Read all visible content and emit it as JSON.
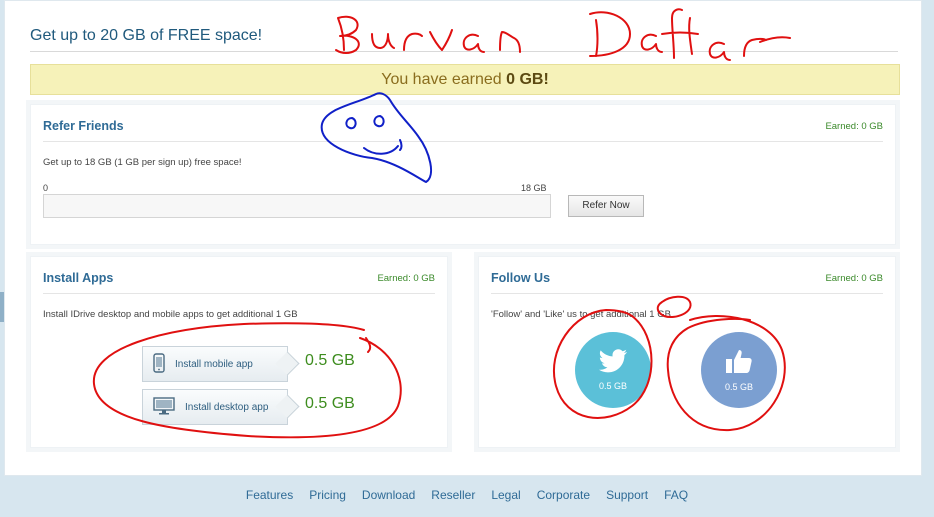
{
  "header": {
    "title": "Get up to 20 GB of FREE space!"
  },
  "banner": {
    "prefix": "You have earned ",
    "amount": "0 GB!"
  },
  "refer": {
    "title": "Refer Friends",
    "earned": "Earned: 0 GB",
    "desc": "Get up to 18 GB (1 GB per sign up) free space!",
    "scale_min": "0",
    "scale_max": "18 GB",
    "progress_fraction": 0,
    "button": "Refer Now"
  },
  "apps": {
    "title": "Install Apps",
    "earned": "Earned: 0 GB",
    "desc": "Install IDrive desktop and mobile apps to get additional 1 GB",
    "mobile_label": "Install mobile app",
    "mobile_gb": "0.5 GB",
    "desktop_label": "Install desktop app",
    "desktop_gb": "0.5 GB"
  },
  "follow": {
    "title": "Follow Us",
    "earned": "Earned: 0 GB",
    "desc": "'Follow' and 'Like' us to get additional 1 GB",
    "twitter_gb": "0.5 GB",
    "facebook_gb": "0.5 GB",
    "twitter_color": "#5bc0d8",
    "facebook_color": "#7b9fd1"
  },
  "footer": {
    "links": [
      "Features",
      "Pricing",
      "Download",
      "Reseller",
      "Legal",
      "Corporate",
      "Support",
      "FAQ"
    ]
  },
  "annotation": {
    "handwriting": "Burvan Daftar"
  }
}
